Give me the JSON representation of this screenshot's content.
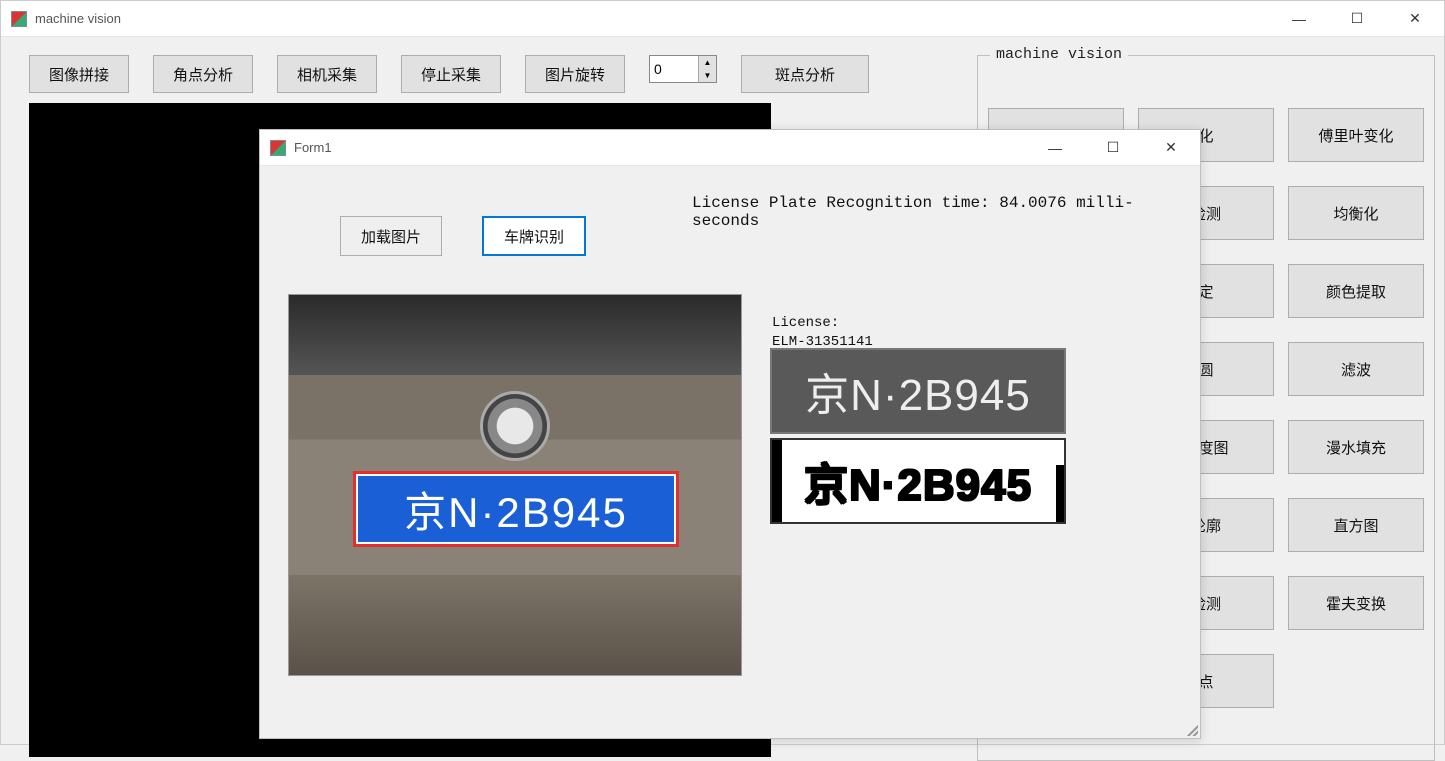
{
  "main": {
    "title": "machine vision",
    "toolbar": {
      "btn_stitch": "图像拼接",
      "btn_corner": "角点分析",
      "btn_camera": "相机采集",
      "btn_stop": "停止采集",
      "btn_rotate": "图片旋转",
      "spinner_value": "0",
      "btn_blob": "斑点分析"
    }
  },
  "groupbox": {
    "title": "machine vision",
    "row1": {
      "c1_partial": "化",
      "c2": "傅里叶变化"
    },
    "row2": {
      "c1_partial": "检测",
      "c2": "均衡化"
    },
    "row3": {
      "c1_partial": "定",
      "c2": "颜色提取"
    },
    "row4": {
      "c1_partial": "圆",
      "c2": "滤波"
    },
    "row5": {
      "c1_partial": "灰度图",
      "c2": "漫水填充"
    },
    "row6": {
      "c1_partial": "轮廓",
      "c2": "直方图"
    },
    "row7": {
      "c1_partial": "检测",
      "c2": "霍夫变换"
    },
    "row8": {
      "c1_partial": "点",
      "c2": ""
    }
  },
  "dialog": {
    "title": "Form1",
    "btn_load": "加载图片",
    "btn_recognize": "车牌识别",
    "recog_time": "License Plate Recognition time: 84.0076 milli-seconds",
    "license_label": "License:\nELM-31351141",
    "plate_text": "京N·2B945",
    "plate_gray_text": "京N·2B945",
    "plate_bw_text": "京N·2B945"
  }
}
